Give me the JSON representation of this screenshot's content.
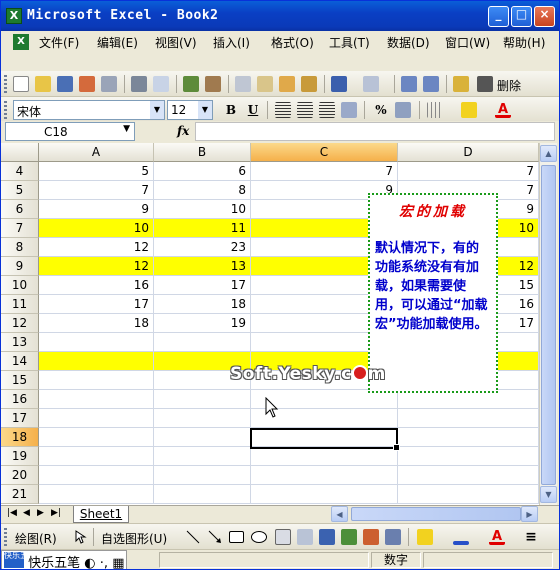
{
  "window": {
    "title": "Microsoft Excel - Book2",
    "controls": [
      "_",
      "□",
      "×"
    ]
  },
  "menubar": {
    "items": [
      "文件(F)",
      "编辑(E)",
      "视图(V)",
      "插入(I)",
      "格式(O)",
      "工具(T)",
      "数据(D)",
      "窗口(W)",
      "帮助(H)"
    ],
    "mdi_controls": [
      "–",
      "▫",
      "×"
    ]
  },
  "standard_toolbar": {
    "delete_label": "删除"
  },
  "format_toolbar": {
    "font_name": "宋体",
    "font_size": "12",
    "bold": "B",
    "underline": "U",
    "percent": "%"
  },
  "formula_bar": {
    "name_box": "C18",
    "fx": "fx",
    "content": ""
  },
  "sheet": {
    "columns": [
      "A",
      "B",
      "C",
      "D"
    ],
    "active_column": "C",
    "active_row": "18",
    "highlight_color": "#ffff00",
    "rows": [
      {
        "n": "4",
        "a": "5",
        "b": "6",
        "c": "7",
        "d": "7",
        "hl": false
      },
      {
        "n": "5",
        "a": "7",
        "b": "8",
        "c": "9",
        "d": "7",
        "hl": false
      },
      {
        "n": "6",
        "a": "9",
        "b": "10",
        "c": "",
        "d": "9",
        "hl": false
      },
      {
        "n": "7",
        "a": "10",
        "b": "11",
        "c": "",
        "d": "10",
        "hl": true
      },
      {
        "n": "8",
        "a": "12",
        "b": "23",
        "c": "",
        "d": "",
        "hl": false
      },
      {
        "n": "9",
        "a": "12",
        "b": "13",
        "c": "",
        "d": "12",
        "hl": true
      },
      {
        "n": "10",
        "a": "16",
        "b": "17",
        "c": "",
        "d": "15",
        "hl": false
      },
      {
        "n": "11",
        "a": "17",
        "b": "18",
        "c": "",
        "d": "16",
        "hl": false
      },
      {
        "n": "12",
        "a": "18",
        "b": "19",
        "c": "",
        "d": "17",
        "hl": false
      },
      {
        "n": "13",
        "a": "",
        "b": "",
        "c": "",
        "d": "",
        "hl": false
      },
      {
        "n": "14",
        "a": "",
        "b": "",
        "c": "",
        "d": "",
        "hl": true
      },
      {
        "n": "15",
        "a": "",
        "b": "",
        "c": "",
        "d": "",
        "hl": false
      },
      {
        "n": "16",
        "a": "",
        "b": "",
        "c": "",
        "d": "",
        "hl": false
      },
      {
        "n": "17",
        "a": "",
        "b": "",
        "c": "",
        "d": "",
        "hl": false
      },
      {
        "n": "18",
        "a": "",
        "b": "",
        "c": "",
        "d": "",
        "hl": false
      },
      {
        "n": "19",
        "a": "",
        "b": "",
        "c": "",
        "d": "",
        "hl": false
      },
      {
        "n": "20",
        "a": "",
        "b": "",
        "c": "",
        "d": "",
        "hl": false
      },
      {
        "n": "21",
        "a": "",
        "b": "",
        "c": "",
        "d": "",
        "hl": false
      }
    ]
  },
  "note": {
    "title": "宏的加载",
    "body": "默认情况下，有的功能系统没有有加载，如果需要使用，可以通过“加载宏”功能加载使用。",
    "border_color": "#1a9a1a",
    "title_color": "#e00000",
    "body_color": "#0000cc"
  },
  "watermark": {
    "text": "Soft.Yesky.c",
    "suffix": "m"
  },
  "sheet_tabs": {
    "active": "Sheet1"
  },
  "drawing_toolbar": {
    "draw_label": "绘图(R)",
    "autoshapes_label": "自选图形(U)"
  },
  "statusbar": {
    "ime_name": "快乐五笔",
    "ime_logo": "快乐五笔",
    "mode": "数字"
  }
}
